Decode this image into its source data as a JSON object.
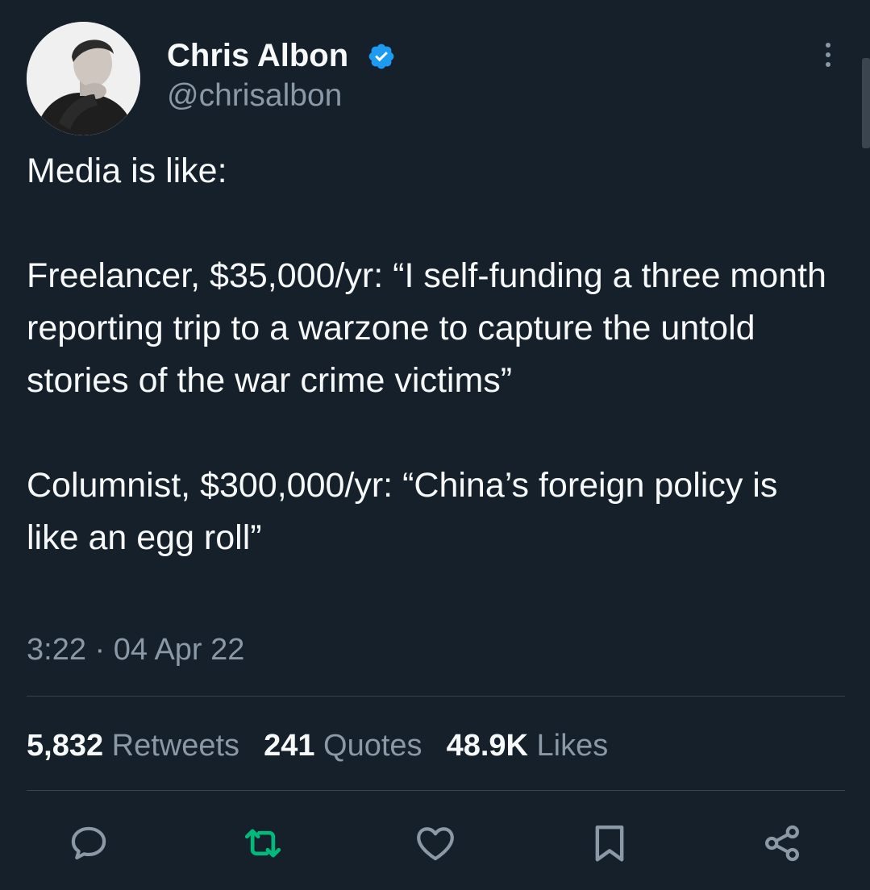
{
  "author": {
    "name": "Chris Albon",
    "handle": "@chrisalbon",
    "verified_icon": "verified-badge-icon"
  },
  "tweet": {
    "text": "Media is like:\n\nFreelancer, $35,000/yr: “I self-funding a three month reporting trip to a warzone to capture the untold stories of the war crime victims”\n\nColumnist, $300,000/yr: “China’s foreign policy is like an egg roll”",
    "timestamp": "3:22 · 04 Apr 22"
  },
  "stats": {
    "retweets_count": "5,832",
    "retweets_label": "Retweets",
    "quotes_count": "241",
    "quotes_label": "Quotes",
    "likes_count": "48.9K",
    "likes_label": "Likes"
  },
  "actions": [
    "reply-icon",
    "retweet-icon",
    "like-icon",
    "bookmark-icon",
    "share-icon"
  ],
  "colors": {
    "background": "#15202b",
    "text": "#f7f9f9",
    "secondary_text": "#8b98a5",
    "verified": "#1d9bf0",
    "retweet_active": "#00ba7c",
    "divider": "#38444d"
  }
}
